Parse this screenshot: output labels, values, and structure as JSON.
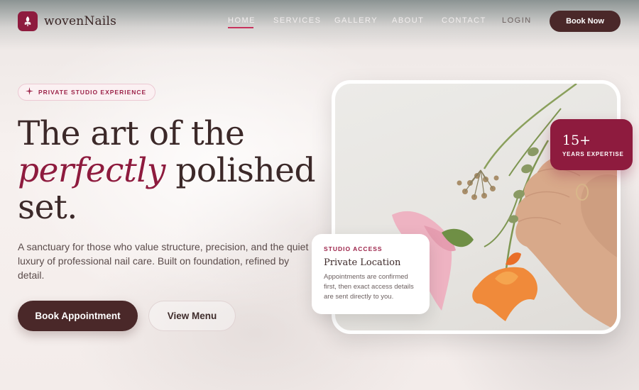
{
  "brand": {
    "name": "wovenNails",
    "logo_icon": "flower-icon"
  },
  "nav": {
    "items": [
      {
        "label": "HOME",
        "active": true
      },
      {
        "label": "SERVICES",
        "active": false
      },
      {
        "label": "GALLERY",
        "active": false
      },
      {
        "label": "ABOUT",
        "active": false
      },
      {
        "label": "CONTACT",
        "active": false
      }
    ],
    "login": "LOGIN",
    "cta": "Book Now"
  },
  "hero": {
    "badge": {
      "icon": "sparkle-icon",
      "text": "PRIVATE STUDIO EXPERIENCE"
    },
    "headline": {
      "line1": "The art of the",
      "accent": "perfectly",
      "line2_rest": " polished",
      "line3": "set."
    },
    "description": "A sanctuary for those who value structure, precision, and the quiet luxury of professional nail care. Built on foundation, refined by detail.",
    "primary_cta": "Book Appointment",
    "secondary_cta": "View Menu"
  },
  "stats": {
    "number": "15+",
    "label": "YEARS EXPERTISE"
  },
  "access_card": {
    "kicker": "STUDIO ACCESS",
    "title": "Private Location",
    "body": "Appointments are confirmed first, then exact access details are sent directly to you."
  },
  "colors": {
    "brand": "#8e1b3e",
    "dark": "#4a2829",
    "nav_active_underline": "#c8335d",
    "background": "#f6efed"
  }
}
